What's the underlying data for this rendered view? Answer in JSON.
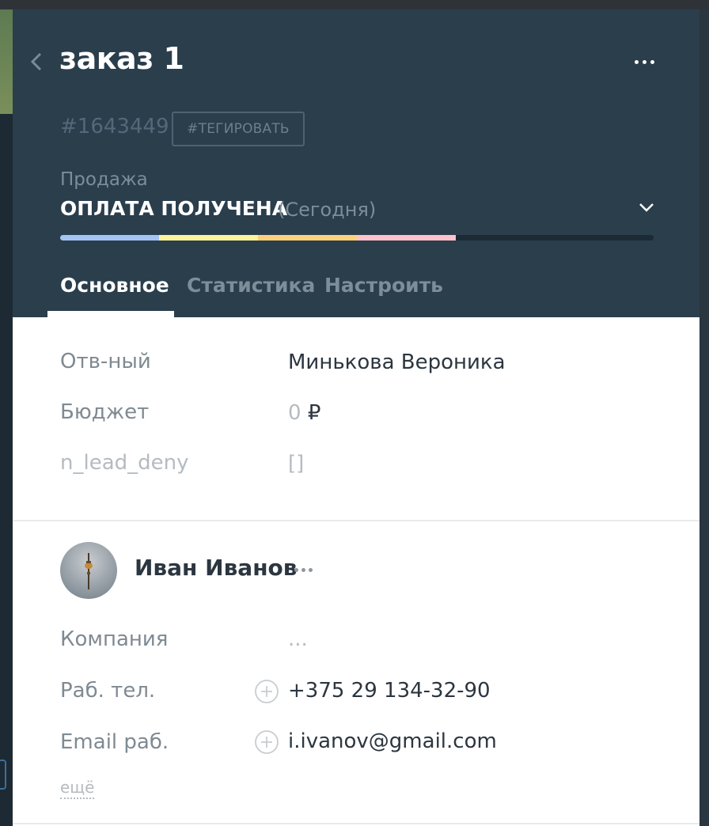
{
  "header": {
    "title": "заказ 1",
    "order_id": "#1643449",
    "tag_button": "#ТЕГИРОВАТЬ",
    "pipeline": "Продажа",
    "stage": "ОПЛАТА ПОЛУЧЕНА",
    "stage_date": "(Сегодня)",
    "progress_colors": [
      "#a4c5f4",
      "#fdf49b",
      "#fbd17b",
      "#fbc3cb"
    ],
    "progress_filled_segments": 4,
    "progress_total_segments": 6
  },
  "tabs": [
    {
      "label": "Основное",
      "active": true
    },
    {
      "label": "Статистика",
      "active": false
    },
    {
      "label": "Настроить",
      "active": false
    }
  ],
  "fields": [
    {
      "label": "Отв-ный",
      "value": "Минькова Вероника"
    },
    {
      "label": "Бюджет",
      "value_number": "0",
      "value_currency": "₽"
    },
    {
      "label": "n_lead_deny",
      "value": "[]"
    }
  ],
  "contact": {
    "name": "Иван Иванов",
    "fields": [
      {
        "label": "Компания",
        "value": "..."
      },
      {
        "label": "Раб. тел.",
        "value": "+375 29 134-32-90"
      },
      {
        "label": "Email раб.",
        "value": "i.ivanov@gmail.com"
      }
    ],
    "more_link": "ещё"
  },
  "icons": {
    "back": "chevron-left-icon",
    "menu": "more-horizontal-icon",
    "stage_toggle": "chevron-down-icon",
    "add": "plus-circle-icon"
  }
}
